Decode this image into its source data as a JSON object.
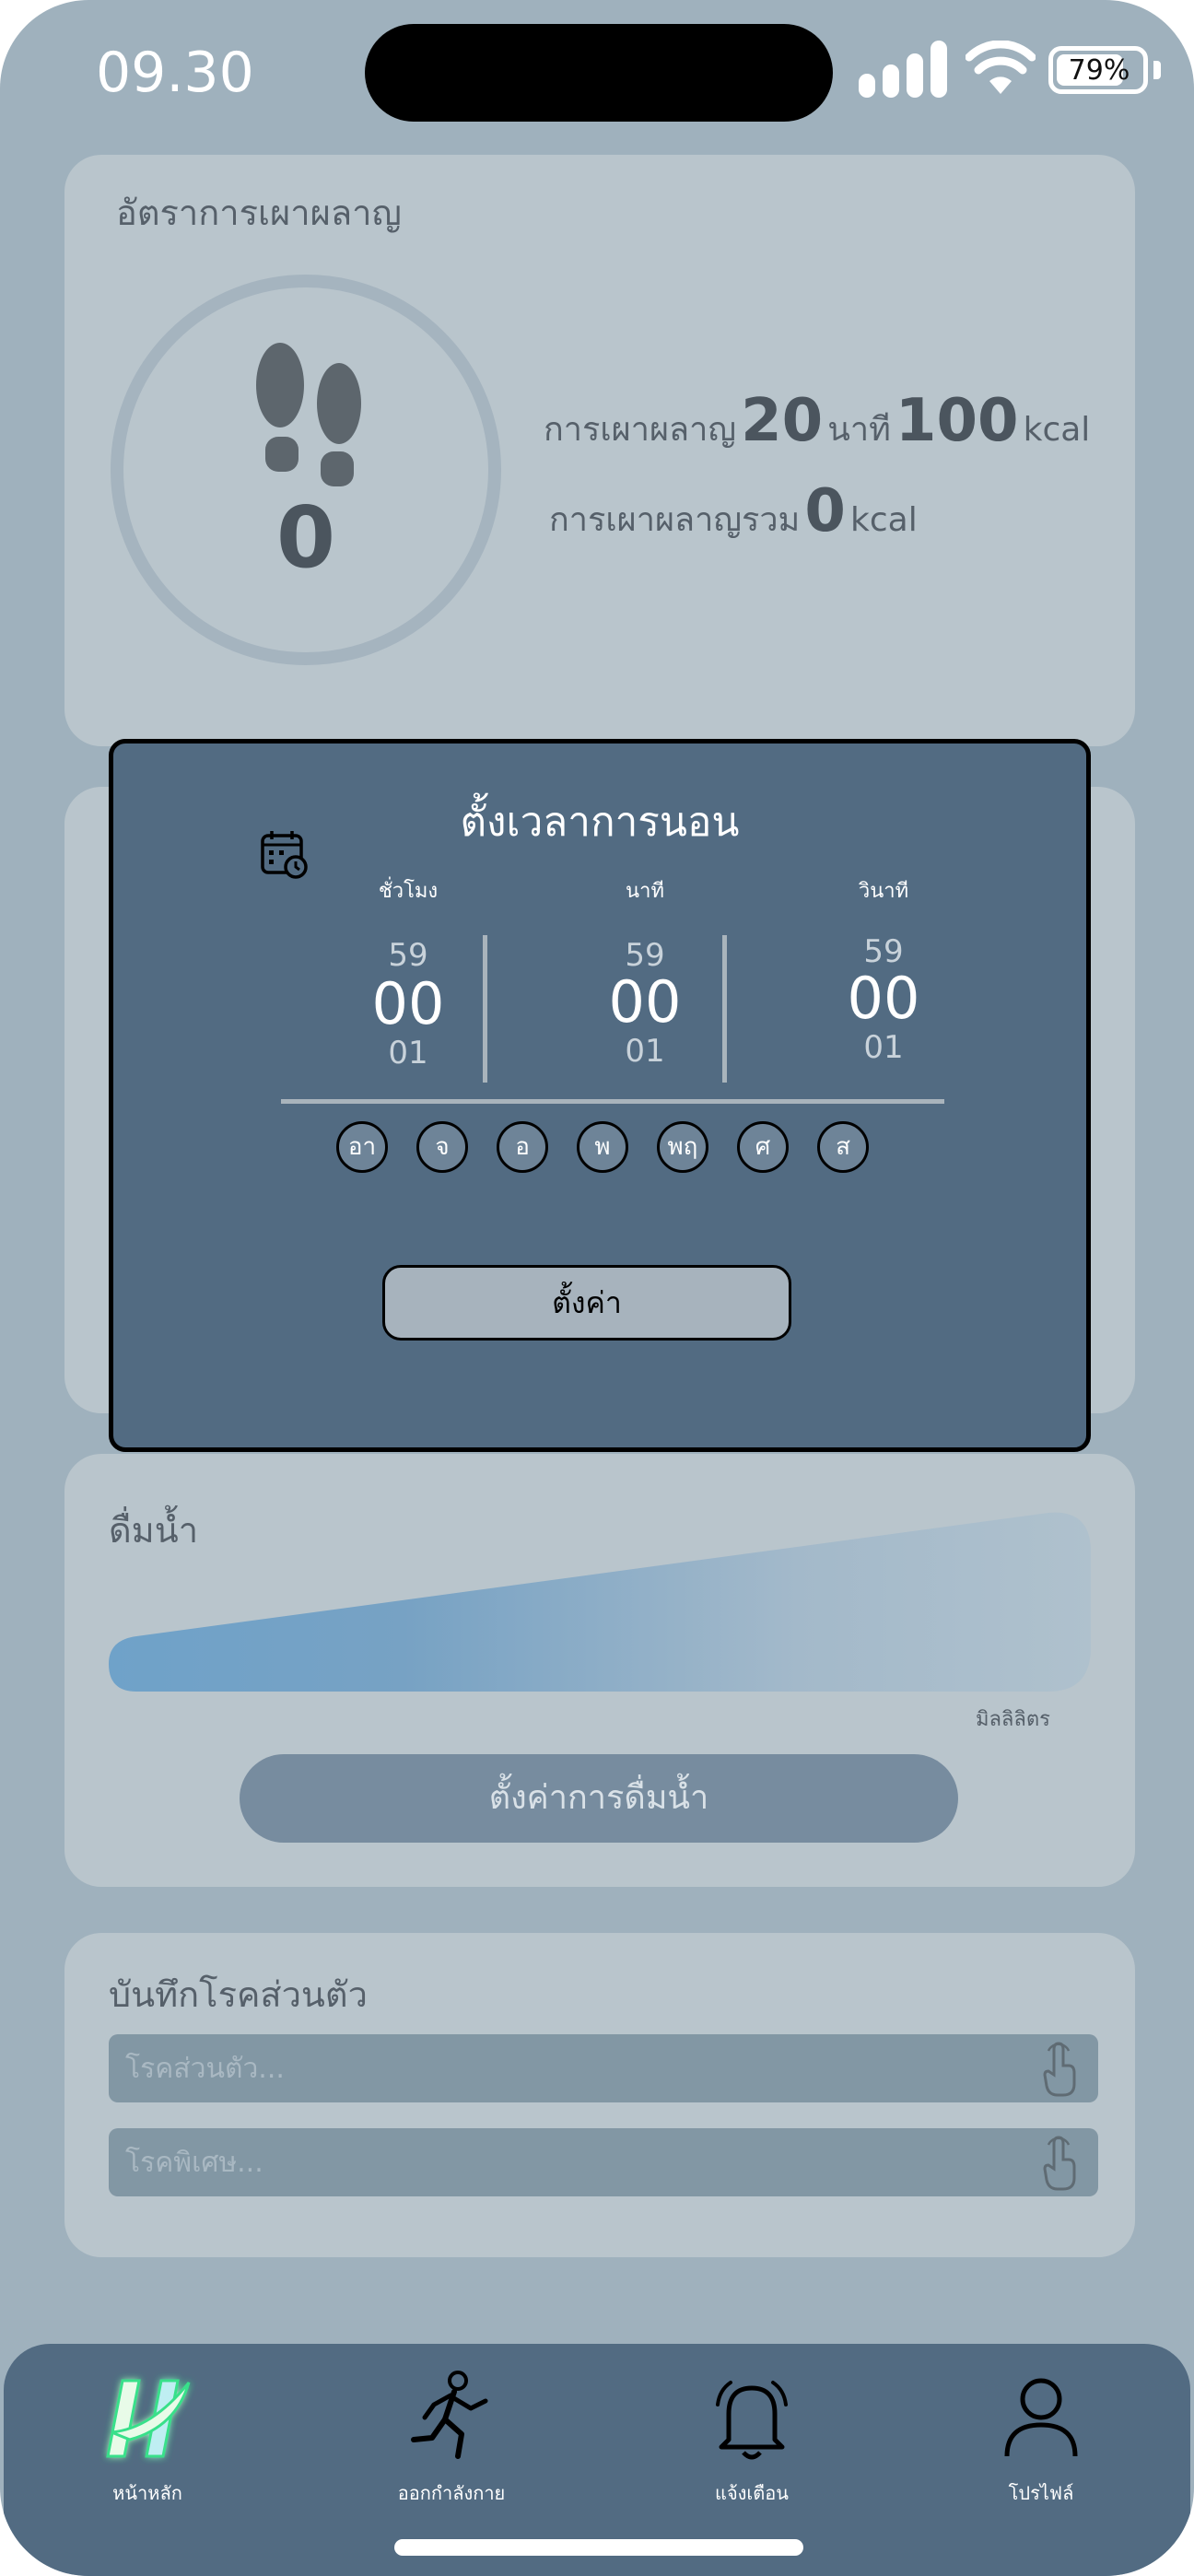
{
  "status_bar": {
    "time": "09.30",
    "battery": "79%"
  },
  "burn_card": {
    "title": "อัตราการเผาผลาญ",
    "steps": "0",
    "burn_label": "การเผาผลาญ",
    "burn_minutes": "20",
    "minutes_unit": "นาที",
    "burn_kcal": "100",
    "kcal_unit": "kcal",
    "total_label": "การเผาผลาญรวม",
    "total_kcal": "0",
    "total_unit": "kcal"
  },
  "sleep_modal": {
    "title": "ตั้งเวลาการนอน",
    "columns": [
      {
        "label": "ชั่วโมง",
        "prev": "59",
        "current": "00",
        "next": "01"
      },
      {
        "label": "นาที",
        "prev": "59",
        "current": "00",
        "next": "01"
      },
      {
        "label": "วินาที",
        "prev": "59",
        "current": "00",
        "next": "01"
      }
    ],
    "days": [
      "อา",
      "จ",
      "อ",
      "พ",
      "พฤ",
      "ศ",
      "ส"
    ],
    "set_button": "ตั้งค่า"
  },
  "water_card": {
    "title": "ดื่มน้ำ",
    "unit": "มิลลิลิตร",
    "button": "ตั้งค่าการดื่มน้ำ"
  },
  "disease_card": {
    "title": "บันทึกโรคส่วนตัว",
    "personal_placeholder": "โรคส่วนตัว...",
    "special_placeholder": "โรคพิเศษ..."
  },
  "bottom_nav": {
    "items": [
      {
        "label": "หน้าหลัก",
        "icon": "home-logo-icon"
      },
      {
        "label": "ออกกำลังกาย",
        "icon": "running-icon"
      },
      {
        "label": "แจ้งเตือน",
        "icon": "bell-icon"
      },
      {
        "label": "โปรไฟล์",
        "icon": "user-icon"
      }
    ]
  },
  "colors": {
    "background": "#9fb1bd",
    "card": "#b9c5cc",
    "modal": "#526b82",
    "nav": "#526b82",
    "water_fill": "#6fa2c9",
    "home_accent": "#39e08a"
  }
}
